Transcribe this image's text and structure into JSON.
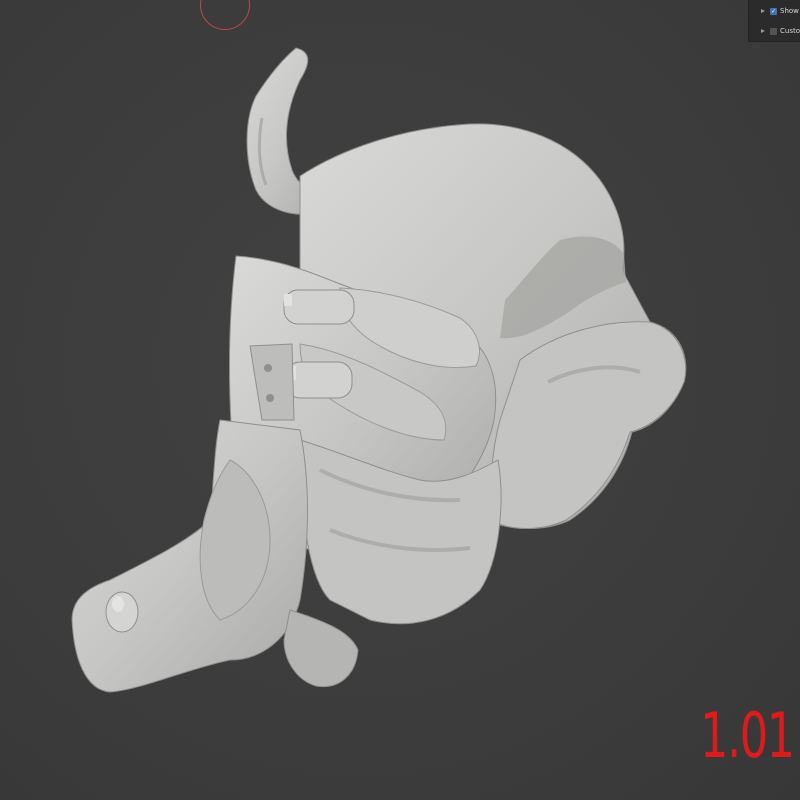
{
  "overlay": {
    "items": [
      {
        "label": "Show G",
        "checked": true
      },
      {
        "label": "Custom",
        "checked": false
      }
    ]
  },
  "annotation": {
    "version": "1.01",
    "color": "#e01a1a"
  },
  "colors": {
    "background": "#3d3d3d",
    "mesh": "#c9c9c7",
    "checkbox_on": "#4772b3",
    "brush_cursor": "#c2464a"
  },
  "icons": {
    "expand": "triangle-right-icon",
    "check": "checkmark-icon"
  }
}
